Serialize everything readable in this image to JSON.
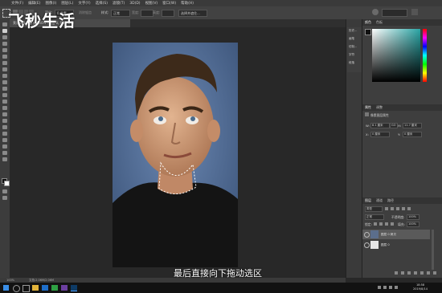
{
  "menubar": {
    "items": [
      "文件(F)",
      "编辑(E)",
      "图像(I)",
      "图层(L)",
      "文字(Y)",
      "选择(S)",
      "滤镜(T)",
      "3D(D)",
      "视图(V)",
      "窗口(W)",
      "帮助(H)"
    ]
  },
  "options": {
    "feather_label": "羽化:",
    "feather_value": "0 像素",
    "antialias": "消除锯齿",
    "style_label": "样式:",
    "style_value": "正常",
    "width_label": "宽度:",
    "height_label": "高度:",
    "refine_button": "选择并遮住..."
  },
  "document": {
    "tab": "莱昂纳多.jpg @ 100% (图层 0, RGB/8#)",
    "status_zoom": "100%",
    "status_doc": "文档:2.06M/2.06M"
  },
  "mini_panel": {
    "items": [
      "历史...",
      "画笔",
      "仿制...",
      "字符",
      "段落"
    ]
  },
  "color_panel": {
    "tabs": [
      "颜色",
      "色板"
    ],
    "hue_color": "#2aa5a5"
  },
  "properties_panel": {
    "tabs": [
      "属性",
      "调整"
    ],
    "title": "像素图层属性",
    "w_label": "W:",
    "w_value": "8.1 厘米",
    "go_label": "GO",
    "h_label": "H:",
    "h_value": "11.7 厘米",
    "x_label": "X:",
    "x_value": "0 厘米",
    "y_label": "Y:",
    "y_value": "0 厘米"
  },
  "layers_panel": {
    "tabs": [
      "图层",
      "通道",
      "路径"
    ],
    "filter_label": "类型",
    "blend_mode": "正常",
    "opacity_label": "不透明度:",
    "opacity_value": "100%",
    "lock_label": "锁定:",
    "fill_label": "填充:",
    "fill_value": "100%",
    "layers": [
      {
        "name": "图层 0 拷贝"
      },
      {
        "name": "图层 0"
      }
    ]
  },
  "taskbar": {
    "time": "18:58",
    "date": "2019/8/14"
  },
  "watermark": "飞秒生活",
  "caption": "最后直接向下拖动选区"
}
